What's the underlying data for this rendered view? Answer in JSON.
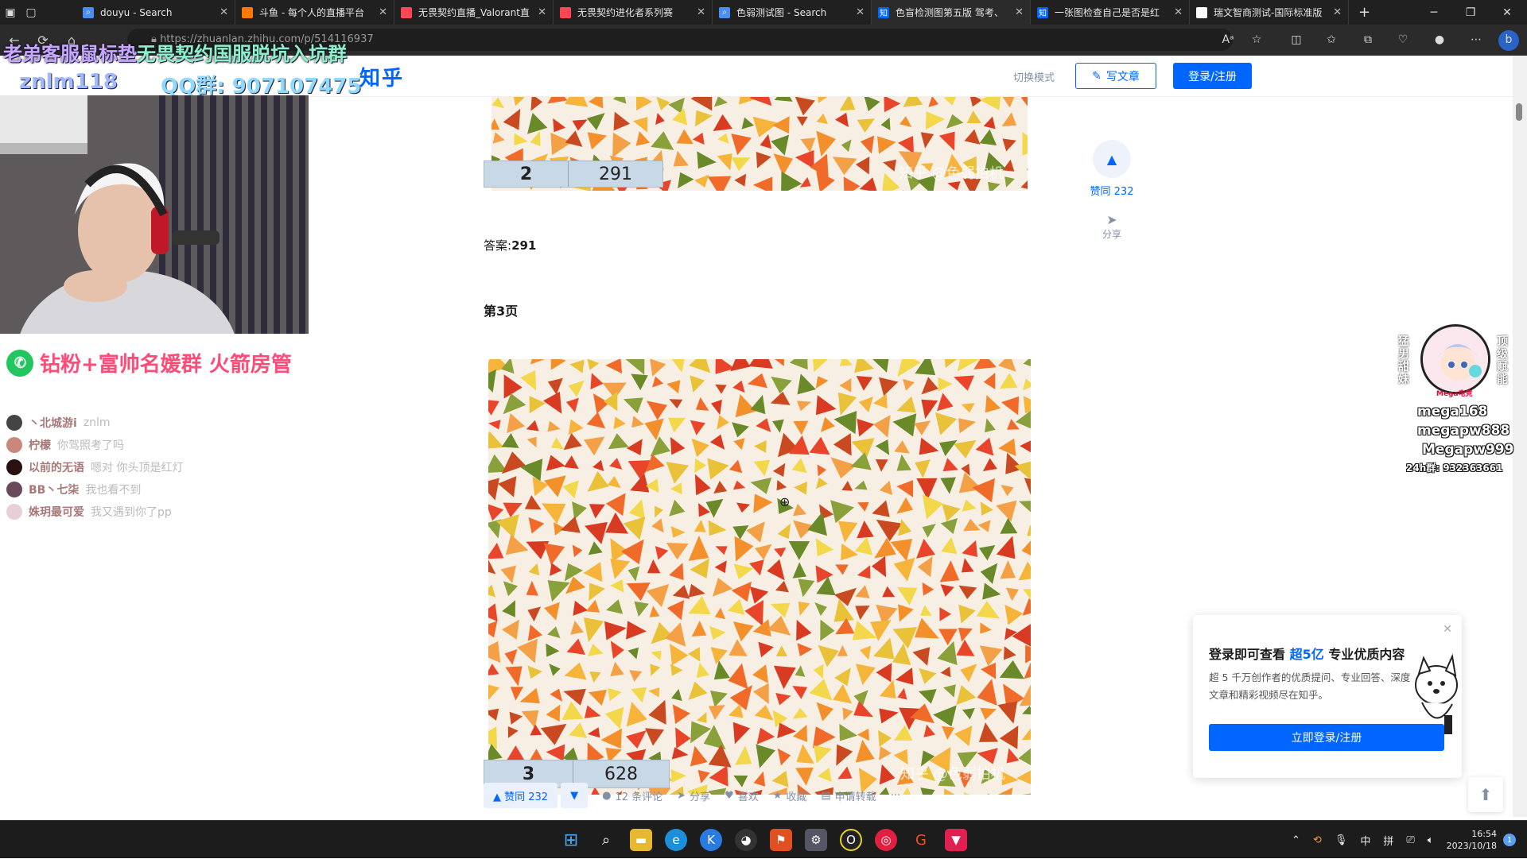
{
  "browser": {
    "tabs": [
      {
        "title": "douyu - Search",
        "icon": "search-icon",
        "color": "#4a8ef0"
      },
      {
        "title": "斗鱼 - 每个人的直播平台",
        "icon": "douyu-icon",
        "color": "#ff7a00"
      },
      {
        "title": "无畏契约直播_Valorant直",
        "icon": "valorant-icon",
        "color": "#ff4655"
      },
      {
        "title": "无畏契约进化者系列赛",
        "icon": "valorant-icon",
        "color": "#ff4655"
      },
      {
        "title": "色弱测试图 - Search",
        "icon": "search-icon",
        "color": "#4a8ef0"
      },
      {
        "title": "色盲检测图第五版 驾考、",
        "icon": "zhihu-icon",
        "color": "#0066ff",
        "active": true
      },
      {
        "title": "一张图检查自己是否是红",
        "icon": "zhihu-icon",
        "color": "#0066ff"
      },
      {
        "title": "瑞文智商测试-国际标准版",
        "icon": "page-icon",
        "color": "#ffffff"
      }
    ],
    "url": "https://zhuanlan.zhihu.com/p/514116937"
  },
  "overlay": {
    "title_a": "老弟客服鼠标垫",
    "title_b": "无畏契约国服脱坑入坑群",
    "user": "znlm118",
    "qq": "QQ群: 907107475",
    "wechat": "钻粉+富帅名媛群 火箭房管",
    "chat": [
      {
        "name": "丶北城游i",
        "msg": "znlm",
        "color": "#444"
      },
      {
        "name": "柠檬",
        "msg": "你驾照考了吗",
        "color": "#c9887a"
      },
      {
        "name": "以前的无语",
        "msg": "嗯对 你头顶是红灯",
        "color": "#2a1010"
      },
      {
        "name": "BB丶七柒",
        "msg": "我也看不到",
        "color": "#6a4a5a"
      },
      {
        "name": "姝玥最可爱",
        "msg": "我又遇到你了pp",
        "color": "#e6d0d8"
      }
    ],
    "promo": {
      "side_left": "猛男甜妹",
      "side_right": "顶级赋能",
      "badge": "Mega电竞",
      "line1": "mega168",
      "line2": "megapw888",
      "line3": "Megapw999",
      "line4": "24h群: 932363661"
    }
  },
  "zhihu": {
    "logo": "知乎",
    "switch_mode": "切换模式",
    "write": "写文章",
    "login": "登录/注册",
    "plate2": {
      "num": "2",
      "code": "291"
    },
    "watermark": "知乎 @色弱拍机",
    "answer_label": "答案:",
    "answer_value": "291",
    "page_heading": "第3页",
    "plate3": {
      "num": "3",
      "code": "628"
    },
    "side_vote": "赞同 232",
    "side_share": "分享",
    "actions": {
      "vote": "▲ 赞同 232",
      "comments": "12 条评论",
      "share": "分享",
      "like": "喜欢",
      "fav": "收藏",
      "reprint": "申请转载",
      "more": "···"
    },
    "popup": {
      "title_pre": "登录即可查看",
      "title_em": "超5亿",
      "title_post": "专业优质内容",
      "desc": "超 5 千万创作者的优质提问、专业回答、深度文章和精彩视频尽在知乎。",
      "button": "立即登录/注册"
    }
  },
  "taskbar": {
    "time": "16:54",
    "date": "2023/10/18",
    "ime1": "中",
    "ime2": "拼",
    "notifications": "1"
  }
}
